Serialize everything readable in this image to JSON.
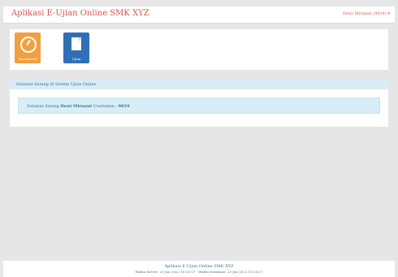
{
  "app": {
    "title": "Aplikasi E-Ujian Online SMK XYZ"
  },
  "navbar": {
    "user_label": "Dewi Mirnawi (9034) ▾"
  },
  "tiles": [
    {
      "label": "Dashboard",
      "icon": "gauge-icon",
      "color": "#f0a040"
    },
    {
      "label": "Ujian",
      "icon": "document-icon",
      "color": "#2f6fb5"
    }
  ],
  "welcome": {
    "heading": "Selamat datang di Sistem Ujian Online",
    "prefix": "Selamat datang ",
    "name": "Dewi Mirnawi",
    "username_label": " Username : ",
    "username": "9034"
  },
  "footer": {
    "line1": "Aplikasi E-Ujian Online SMK XYZ",
    "line2": "Waktu Server: 23 Jun 2022 10:20:17 - Waktu Database: 23 Jun 2022 10:20:17"
  }
}
